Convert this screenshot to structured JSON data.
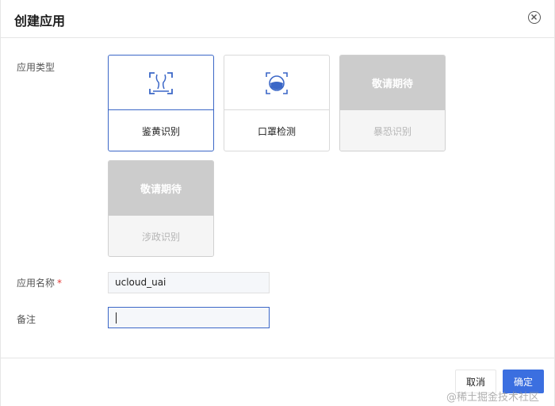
{
  "dialog": {
    "title": "创建应用",
    "close_icon": "close-circle-icon"
  },
  "form": {
    "app_type_label": "应用类型",
    "app_name_label": "应用名称",
    "app_name_required_mark": "*",
    "app_name_value": "ucloud_uai",
    "remark_label": "备注",
    "remark_value": ""
  },
  "cards": [
    {
      "label": "鉴黄识别",
      "icon": "face-scan-icon",
      "state": "selected"
    },
    {
      "label": "口罩检测",
      "icon": "mask-scan-icon",
      "state": "available"
    },
    {
      "label": "暴恐识别",
      "overlay": "敬请期待",
      "state": "disabled"
    },
    {
      "label": "涉政识别",
      "overlay": "敬请期待",
      "state": "disabled"
    }
  ],
  "footer": {
    "cancel_label": "取消",
    "ok_label": "确定"
  },
  "watermark": "@稀土掘金技术社区",
  "colors": {
    "accent": "#3b6fe0",
    "selected_border": "#3b67c7",
    "disabled_fill": "#cccccc",
    "required": "#e53935"
  }
}
